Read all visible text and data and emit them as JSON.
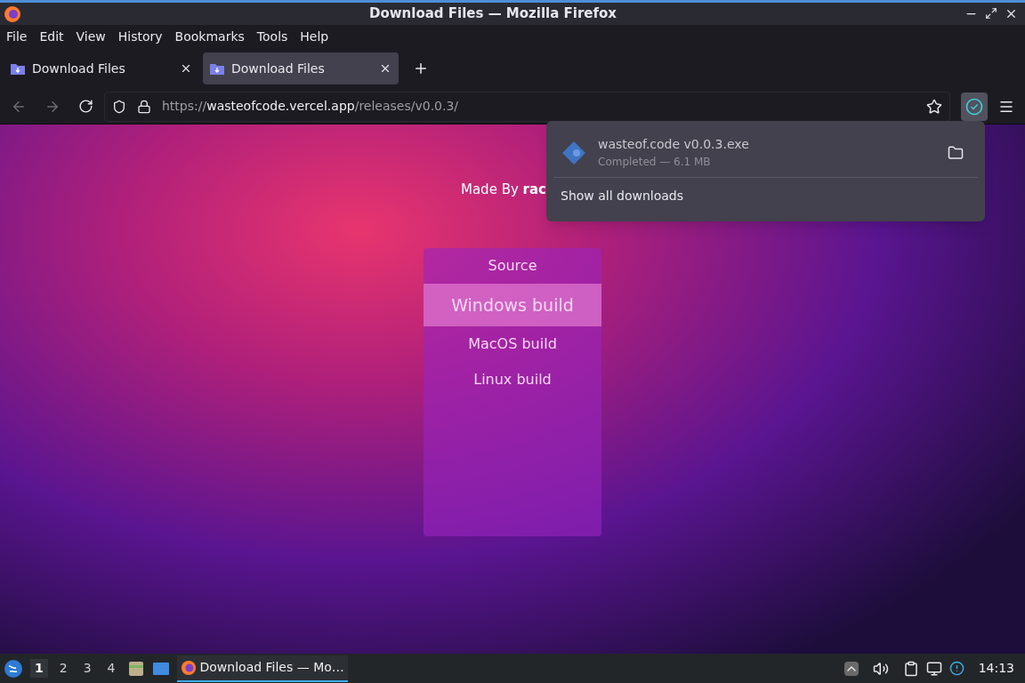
{
  "window": {
    "title": "Download Files — Mozilla Firefox"
  },
  "menu": [
    "File",
    "Edit",
    "View",
    "History",
    "Bookmarks",
    "Tools",
    "Help"
  ],
  "tabs": [
    {
      "label": "Download Files",
      "selected": false
    },
    {
      "label": "Download Files",
      "selected": true
    }
  ],
  "address": {
    "scheme": "https://",
    "host": "wasteofcode.vercel.app",
    "path": "/releases/v0.0.3/"
  },
  "page": {
    "credit": "Made By **rac**",
    "links": [
      {
        "label": "Source",
        "selected": false
      },
      {
        "label": "Windows build",
        "selected": true
      },
      {
        "label": "MacOS build",
        "selected": false
      },
      {
        "label": "Linux build",
        "selected": false
      }
    ]
  },
  "downloads_panel": {
    "file": "wasteof.code v0.0.3.exe",
    "status": "Completed — 6.1 MB",
    "show_all": "Show all downloads"
  },
  "taskbar": {
    "workspaces": [
      {
        "label": "1",
        "selected": true
      },
      {
        "label": "2",
        "selected": false
      },
      {
        "label": "3",
        "selected": false
      },
      {
        "label": "4",
        "selected": false
      }
    ],
    "task": "Download Files — Mo…",
    "clock": "14:13"
  }
}
